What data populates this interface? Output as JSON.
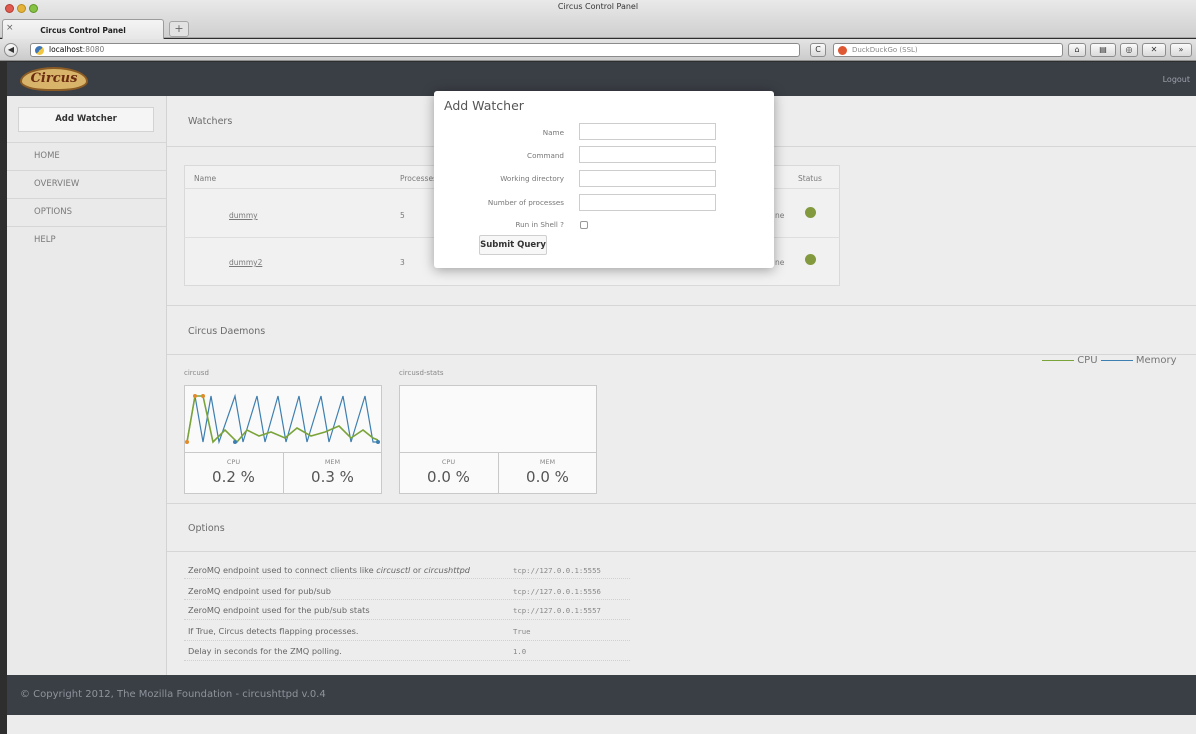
{
  "window": {
    "title": "Circus Control Panel"
  },
  "tab": {
    "label": "Circus Control Panel",
    "close": "×",
    "new_tab": "+"
  },
  "nav": {
    "back": "◀",
    "url_host": "localhost",
    "url_port": ":8080",
    "search_placeholder": "DuckDuckGo (SSL)",
    "reload": "C"
  },
  "header": {
    "logo": "Circus",
    "logout": "Logout"
  },
  "sidebar": {
    "add_watcher": "Add Watcher",
    "items": [
      "HOME",
      "OVERVIEW",
      "OPTIONS",
      "HELP"
    ]
  },
  "watchers": {
    "title": "Watchers",
    "columns": {
      "name": "Name",
      "processes": "Processes",
      "status": "Status"
    },
    "rows": [
      {
        "name": "dummy",
        "processes": "5",
        "status_text": "ne",
        "status_color": "#82993d"
      },
      {
        "name": "dummy2",
        "processes": "3",
        "status_text": "ne",
        "status_color": "#82993d"
      }
    ]
  },
  "daemons": {
    "title": "Circus Daemons",
    "legend": {
      "cpu": "CPU",
      "memory": "Memory"
    },
    "colors": {
      "cpu": "#7aa43a",
      "memory": "#3d7fb0"
    },
    "items": [
      {
        "name": "circusd",
        "cpu_label": "CPU",
        "cpu": "0.2 %",
        "mem_label": "MEM",
        "mem": "0.3 %"
      },
      {
        "name": "circusd-stats",
        "cpu_label": "CPU",
        "cpu": "0.0 %",
        "mem_label": "MEM",
        "mem": "0.0 %"
      }
    ]
  },
  "options": {
    "title": "Options",
    "rows": [
      {
        "label_pre": "ZeroMQ endpoint used to connect clients like ",
        "em1": "circusctl",
        "mid": " or ",
        "em2": "circushttpd",
        "value": "tcp://127.0.0.1:5555"
      },
      {
        "label_pre": "ZeroMQ endpoint used for pub/sub",
        "em1": "",
        "mid": "",
        "em2": "",
        "value": "tcp://127.0.0.1:5556"
      },
      {
        "label_pre": "ZeroMQ endpoint used for the pub/sub stats",
        "em1": "",
        "mid": "",
        "em2": "",
        "value": "tcp://127.0.0.1:5557"
      },
      {
        "label_pre": "If True, Circus detects flapping processes.",
        "em1": "",
        "mid": "",
        "em2": "",
        "value": "True"
      },
      {
        "label_pre": "Delay in seconds for the ZMQ polling.",
        "em1": "",
        "mid": "",
        "em2": "",
        "value": "1.0"
      }
    ]
  },
  "footer": {
    "text": "© Copyright 2012, The Mozilla Foundation - circushttpd v.0.4"
  },
  "modal": {
    "title": "Add Watcher",
    "fields": {
      "name": "Name",
      "command": "Command",
      "working_dir": "Working directory",
      "num_processes": "Number of processes",
      "run_in_shell": "Run in Shell ?"
    },
    "submit": "Submit Query"
  }
}
